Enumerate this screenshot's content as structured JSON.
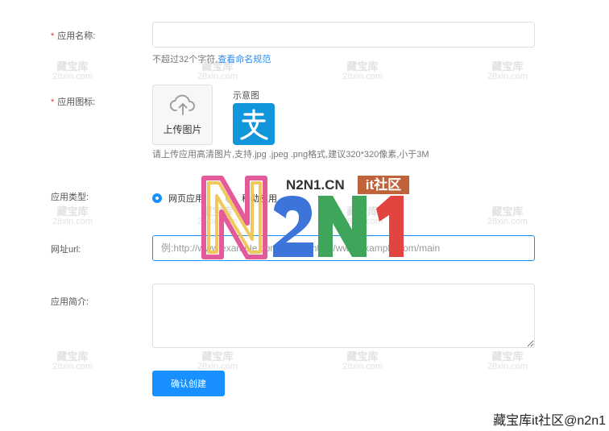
{
  "form": {
    "app_name": {
      "required_mark": "*",
      "label": "应用名称:",
      "value": "",
      "placeholder": "",
      "hint": "不超过32个字符,",
      "hint_link": "查看命名规范"
    },
    "app_icon": {
      "required_mark": "*",
      "label": "应用图标:",
      "upload_label": "上传图片",
      "example_label": "示意图",
      "hint": "请上传应用高清图片,支持.jpg .jpeg .png格式,建议320*320像素,小于3M"
    },
    "app_type": {
      "label": "应用类型:",
      "options": [
        {
          "label": "网页应用",
          "selected": true
        },
        {
          "label": "移动应用",
          "selected": false
        }
      ]
    },
    "url": {
      "label": "网址url:",
      "value": "",
      "placeholder": "例:http://www.example.com/main或http://www.example.com/main"
    },
    "intro": {
      "label": "应用简介:",
      "value": ""
    },
    "submit_label": "确认创建"
  },
  "watermarks": {
    "tile_line1": "藏宝库",
    "tile_line2": "28xin.com",
    "brand_text": "N2N1.CN",
    "brand_tag": "it社区",
    "footer": "藏宝库it社区@n2n1"
  },
  "colors": {
    "primary": "#1890ff",
    "required": "#e4393c",
    "link": "#2d8cf0",
    "example_icon_bg": "#1296db"
  },
  "icons": {
    "upload": "cloud-upload-icon",
    "example": "alipay-icon"
  }
}
